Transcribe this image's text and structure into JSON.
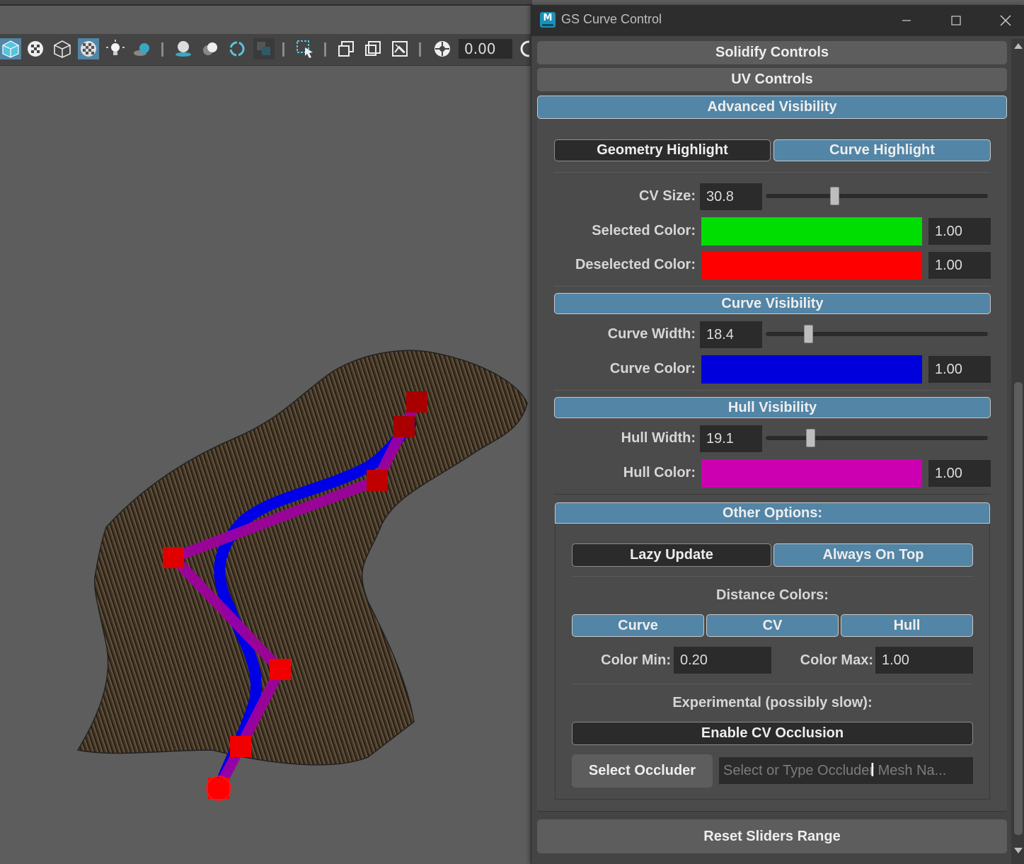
{
  "viewport": {
    "toolbar": {
      "value_field": "0.00"
    },
    "icons": [
      "shaded-cube-icon",
      "textured-sphere-icon",
      "wireframe-cube-icon",
      "checker-icon",
      "light-icon",
      "shadow-icon",
      "ao-icon",
      "motion-blur-icon",
      "aa-icon",
      "isolate-icon",
      "xray-icon",
      "select-camera-icon",
      "safe-frame-icon",
      "resolution-gate-icon",
      "gate-mask-icon",
      "camera-attr-icon"
    ],
    "curve_colors": {
      "curve": "#0000e6",
      "hull": "#a000a0",
      "cv": "#e00000",
      "cv_dark": "#a80000",
      "hair": "#4a3a26"
    }
  },
  "window": {
    "title": "GS Curve Control",
    "app_icon": "M"
  },
  "sections": {
    "solidify": "Solidify Controls",
    "uv": "UV Controls",
    "advanced": "Advanced Visibility"
  },
  "highlight_tabs": {
    "geometry": "Geometry Highlight",
    "curve": "Curve Highlight"
  },
  "cv": {
    "size_label": "CV Size:",
    "size_value": "30.8",
    "size_slider": 0.31,
    "selected_label": "Selected Color:",
    "selected_color": "#00dd00",
    "selected_value": "1.00",
    "deselected_label": "Deselected Color:",
    "deselected_color": "#ff0000",
    "deselected_value": "1.00"
  },
  "curve_vis": {
    "header": "Curve Visibility",
    "width_label": "Curve Width:",
    "width_value": "18.4",
    "width_slider": 0.19,
    "color_label": "Curve Color:",
    "color": "#0000dd",
    "color_value": "1.00"
  },
  "hull_vis": {
    "header": "Hull Visibility",
    "width_label": "Hull Width:",
    "width_value": "19.1",
    "width_slider": 0.2,
    "color_label": "Hull Color:",
    "color": "#cc00b0",
    "color_value": "1.00"
  },
  "other": {
    "header": "Other Options:",
    "lazy": "Lazy Update",
    "always_top": "Always On Top",
    "distance_label": "Distance Colors:",
    "dist_tabs": [
      "Curve",
      "CV",
      "Hull"
    ],
    "color_min_label": "Color Min:",
    "color_min": "0.20",
    "color_max_label": "Color Max:",
    "color_max": "1.00",
    "experimental_label": "Experimental (possibly slow):",
    "enable_occlusion": "Enable CV Occlusion",
    "select_occluder": "Select Occluder",
    "occluder_placeholder": "Select or Type Occluder Mesh Na..."
  },
  "reset": "Reset Sliders Range",
  "accent": "#5285a6"
}
